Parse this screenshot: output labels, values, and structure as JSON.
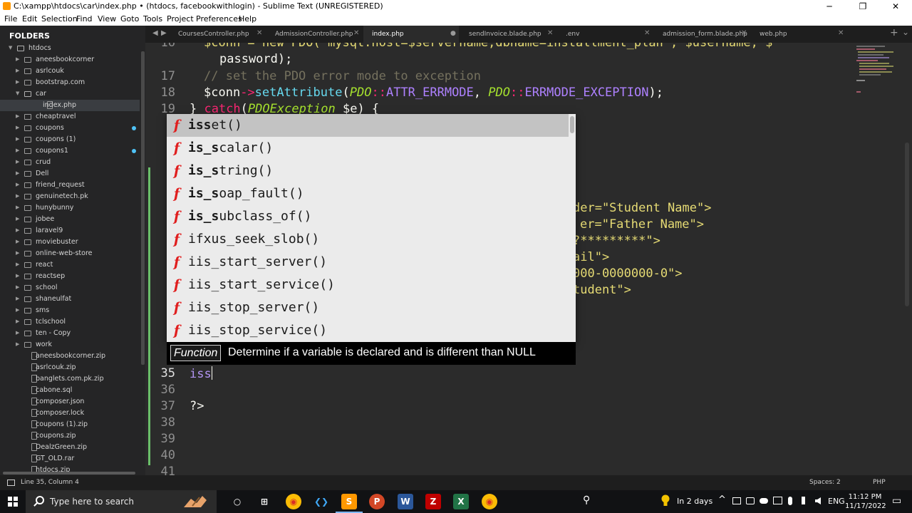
{
  "window": {
    "title": "C:\\xampp\\htdocs\\car\\index.php • (htdocs, facebookwithlogin) - Sublime Text (UNREGISTERED)",
    "minimize": "─",
    "maximize": "❐",
    "close": "✕"
  },
  "menu": [
    "File",
    "Edit",
    "Selection",
    "Find",
    "View",
    "Goto",
    "Tools",
    "Project",
    "Preferences",
    "Help"
  ],
  "sidebar": {
    "heading": "FOLDERS",
    "items": [
      {
        "label": "htdocs",
        "type": "folder-open"
      },
      {
        "label": "aneesbookcorner",
        "type": "folder"
      },
      {
        "label": "asrlcouk",
        "type": "folder"
      },
      {
        "label": "bootstrap.com",
        "type": "folder"
      },
      {
        "label": "car",
        "type": "folder-open"
      },
      {
        "label": "index.php",
        "type": "file"
      },
      {
        "label": "cheaptravel",
        "type": "folder"
      },
      {
        "label": "coupons",
        "type": "folder"
      },
      {
        "label": "coupons (1)",
        "type": "folder"
      },
      {
        "label": "coupons1",
        "type": "folder"
      },
      {
        "label": "crud",
        "type": "folder"
      },
      {
        "label": "Dell",
        "type": "folder"
      },
      {
        "label": "friend_request",
        "type": "folder"
      },
      {
        "label": "genuinetech.pk",
        "type": "folder"
      },
      {
        "label": "hunybunny",
        "type": "folder"
      },
      {
        "label": "jobee",
        "type": "folder"
      },
      {
        "label": "laravel9",
        "type": "folder"
      },
      {
        "label": "moviebuster",
        "type": "folder"
      },
      {
        "label": "online-web-store",
        "type": "folder"
      },
      {
        "label": "react",
        "type": "folder"
      },
      {
        "label": "reactsep",
        "type": "folder"
      },
      {
        "label": "school",
        "type": "folder"
      },
      {
        "label": "shaneulfat",
        "type": "folder"
      },
      {
        "label": "sms",
        "type": "folder"
      },
      {
        "label": "tclschool",
        "type": "folder"
      },
      {
        "label": "ten - Copy",
        "type": "folder"
      },
      {
        "label": "work",
        "type": "folder"
      },
      {
        "label": "aneesbookcorner.zip",
        "type": "zip"
      },
      {
        "label": "asrlcouk.zip",
        "type": "zip"
      },
      {
        "label": "banglets.com.pk.zip",
        "type": "zip"
      },
      {
        "label": "cabone.sql",
        "type": "file"
      },
      {
        "label": "composer.json",
        "type": "json"
      },
      {
        "label": "composer.lock",
        "type": "file"
      },
      {
        "label": "coupons (1).zip",
        "type": "zip"
      },
      {
        "label": "coupons.zip",
        "type": "zip"
      },
      {
        "label": "DealzGreen.zip",
        "type": "zip"
      },
      {
        "label": "GT_OLD.rar",
        "type": "file"
      },
      {
        "label": "htdocs.zip",
        "type": "zip"
      }
    ]
  },
  "tabs": [
    {
      "label": "CoursesController.php",
      "active": false
    },
    {
      "label": "AdmissionController.php",
      "active": false
    },
    {
      "label": "index.php",
      "active": true
    },
    {
      "label": "sendInvoice.blade.php",
      "active": false
    },
    {
      "label": ".env",
      "active": false
    },
    {
      "label": "admission_form.blade.php",
      "active": false
    },
    {
      "label": "web.php",
      "active": false
    }
  ],
  "tabbar": {
    "prev": "◀",
    "next": "▶",
    "add": "+",
    "more": "⌄",
    "close": "✕",
    "dirty": "●"
  },
  "editor": {
    "line_numbers": [
      "16",
      "",
      "17",
      "18",
      "19",
      "2",
      "2",
      "2",
      "2",
      "2",
      "2",
      "2",
      "3",
      "3",
      "3",
      "3",
      "35",
      "36",
      "37",
      "38",
      "39",
      "40",
      "41"
    ],
    "code": {
      "l16a": "$conn = new PDO(\"mysql:host=$servername;dbname=installment_plan\", $username, $",
      "l16b": "password);",
      "l17": "// set the PDO error mode to exception",
      "l18_var": "$conn",
      "l18_arrow": "->",
      "l18_fn": "setAttribute",
      "l18_cls1": "PDO",
      "l18_sep": "::",
      "l18_const1": "ATTR_ERRMODE",
      "l18_cls2": "PDO",
      "l18_const2": "ERRMODE_EXCEPTION",
      "l18_end": ");",
      "l19_brace": "} ",
      "l19_catch": "catch",
      "l19_cls": "PDOException",
      "l19_rest": " $e) {",
      "l35": "iss",
      "l37": "?>"
    },
    "right_fragments": [
      "der=\"Student Name\">",
      "er=\"Father Name\">",
      "?*********\">",
      "ail\">",
      "000-0000000-0\">",
      "tudent\">"
    ]
  },
  "autocomplete": {
    "kind_icon": "f",
    "items": [
      {
        "bold": "iss",
        "rest": "et()"
      },
      {
        "bold": "is_s",
        "rest": "calar()"
      },
      {
        "bold": "is_s",
        "rest": "tring()"
      },
      {
        "bold": "is_s",
        "rest": "oap_fault()"
      },
      {
        "bold": "is_s",
        "rest": "ubclass_of()"
      },
      {
        "text": "ifxus_seek_slob()"
      },
      {
        "text": "iis_start_server()"
      },
      {
        "text": "iis_start_service()"
      },
      {
        "text": "iis_stop_server()"
      },
      {
        "text": "iis_stop_service()"
      }
    ],
    "kind_label": "Function",
    "description": "Determine if a variable is declared and is different than NULL"
  },
  "statusbar": {
    "position": "Line 35, Column 4",
    "spaces": "Spaces: 2",
    "syntax": "PHP"
  },
  "taskbar": {
    "search_placeholder": "Type here to search",
    "apps": [
      {
        "name": "Task View",
        "glyph": "○"
      },
      {
        "name": "Widgets",
        "glyph": "⊞"
      },
      {
        "name": "Chrome",
        "glyph": "◉"
      },
      {
        "name": "VS Code",
        "glyph": "❮❯"
      },
      {
        "name": "Sublime Text",
        "glyph": "S"
      },
      {
        "name": "PowerPoint",
        "glyph": "P"
      },
      {
        "name": "Word",
        "glyph": "W"
      },
      {
        "name": "FileZilla",
        "glyph": "Z"
      },
      {
        "name": "Excel",
        "glyph": "X"
      },
      {
        "name": "Chrome 2",
        "glyph": "◉"
      }
    ],
    "people_glyph": "⚲",
    "weather": "In 2 days",
    "tray_up": "^",
    "language": "ENG",
    "time": "11:12 PM",
    "date": "11/17/2022",
    "notification": "▭"
  },
  "colors": {
    "accent_tab_dirty": "#9a9a9a",
    "modified_gutter": "#6abf69",
    "function_icon": "#e01e1e",
    "sublime_orange": "#ff9800"
  }
}
